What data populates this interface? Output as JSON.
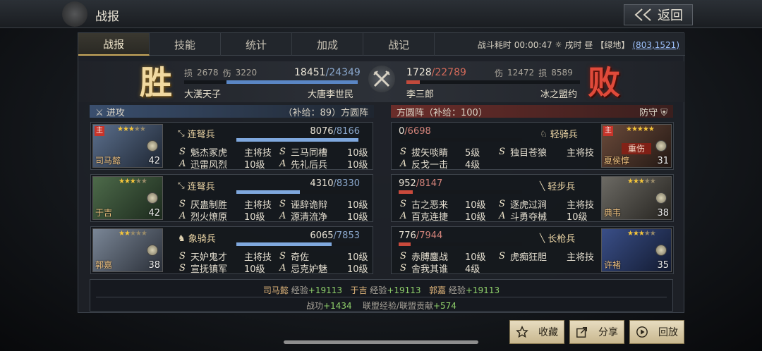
{
  "header": {
    "title": "战报",
    "back_label": "返回"
  },
  "tabs": [
    {
      "label": "战报"
    },
    {
      "label": "技能"
    },
    {
      "label": "统计"
    },
    {
      "label": "加成"
    },
    {
      "label": "战记"
    }
  ],
  "battle_info": {
    "duration_label": "战斗耗时",
    "duration": "00:00:47",
    "time_of_day": "戌时 昼",
    "terrain": "【绿地】",
    "coord": "(803,1521)"
  },
  "attacker": {
    "result": "胜",
    "loss_label": "损",
    "loss": "2678",
    "wound_label": "伤",
    "wound": "3220",
    "troops": "18451",
    "troops_max": "24349",
    "hp_fraction": 0.758,
    "alliance": "大漢天子",
    "player": "大唐李世民",
    "side_label": "进攻",
    "supply_text": "（补给：89）方圆阵"
  },
  "defender": {
    "result": "败",
    "loss_label": "损",
    "loss": "8589",
    "wound_label": "伤",
    "wound": "12472",
    "troops": "1728",
    "troops_max": "22789",
    "hp_fraction": 0.076,
    "alliance": "冰之盟约",
    "player": "李三郎",
    "side_label": "方圆阵（补给：100）",
    "stance": "防守"
  },
  "attack_cards": [
    {
      "name": "司马懿",
      "level": "42",
      "stars": 3,
      "main": "主",
      "troop": "连弩兵",
      "troop_icon": "crossbow-icon",
      "hp": "8076",
      "hp_max": "8166",
      "hp_fraction": 0.989,
      "skills": [
        {
          "type": "S",
          "name": "魁杰冢虎",
          "lv": "主将技"
        },
        {
          "type": "S",
          "name": "三马同槽",
          "lv": "10级"
        },
        {
          "type": "A",
          "name": "迅雷风烈",
          "lv": "10级"
        },
        {
          "type": "A",
          "name": "先礼后兵",
          "lv": "10级"
        }
      ]
    },
    {
      "name": "于吉",
      "level": "42",
      "stars": 3,
      "main": "",
      "troop": "连弩兵",
      "troop_icon": "crossbow-icon",
      "hp": "4310",
      "hp_max": "8330",
      "hp_fraction": 0.517,
      "skills": [
        {
          "type": "S",
          "name": "厌蛊制胜",
          "lv": "主将技"
        },
        {
          "type": "S",
          "name": "诬辞诡辩",
          "lv": "10级"
        },
        {
          "type": "A",
          "name": "烈火燎原",
          "lv": "10级"
        },
        {
          "type": "A",
          "name": "源清流净",
          "lv": "10级"
        }
      ]
    },
    {
      "name": "郭嘉",
      "level": "38",
      "stars": 2,
      "main": "",
      "troop": "象骑兵",
      "troop_icon": "elephant-icon",
      "hp": "6065",
      "hp_max": "7853",
      "hp_fraction": 0.772,
      "skills": [
        {
          "type": "S",
          "name": "天妒鬼才",
          "lv": "主将技"
        },
        {
          "type": "S",
          "name": "奇佐",
          "lv": "10级"
        },
        {
          "type": "S",
          "name": "宣抚镇军",
          "lv": "10级"
        },
        {
          "type": "A",
          "name": "忌克妒魅",
          "lv": "10级"
        }
      ]
    }
  ],
  "defense_cards": [
    {
      "name": "夏侯惇",
      "level": "31",
      "stars": 5,
      "main": "主",
      "status": "重伤",
      "troop": "轻骑兵",
      "troop_icon": "horse-icon",
      "hp": "0",
      "hp_max": "6698",
      "hp_fraction": 0,
      "skills": [
        {
          "type": "S",
          "name": "拔矢啖睛",
          "lv": "5级"
        },
        {
          "type": "S",
          "name": "独目苍狼",
          "lv": "主将技"
        },
        {
          "type": "A",
          "name": "反戈一击",
          "lv": "4级"
        }
      ]
    },
    {
      "name": "典韦",
      "level": "38",
      "stars": 3,
      "main": "",
      "troop": "轻步兵",
      "troop_icon": "sword-icon",
      "hp": "952",
      "hp_max": "8147",
      "hp_fraction": 0.117,
      "skills": [
        {
          "type": "S",
          "name": "古之恶来",
          "lv": "10级"
        },
        {
          "type": "S",
          "name": "逐虎过涧",
          "lv": "主将技"
        },
        {
          "type": "A",
          "name": "百克连捷",
          "lv": "10级"
        },
        {
          "type": "A",
          "name": "斗勇夺械",
          "lv": "10级"
        }
      ]
    },
    {
      "name": "许褚",
      "level": "35",
      "stars": 3,
      "main": "",
      "troop": "长枪兵",
      "troop_icon": "spear-icon",
      "hp": "776",
      "hp_max": "7944",
      "hp_fraction": 0.098,
      "skills": [
        {
          "type": "S",
          "name": "赤膊鏖战",
          "lv": "10级"
        },
        {
          "type": "S",
          "name": "虎痴狂胆",
          "lv": "主将技"
        },
        {
          "type": "S",
          "name": "舍我其谁",
          "lv": "4级"
        }
      ]
    }
  ],
  "rewards": {
    "exp_label": "经验",
    "exp": [
      {
        "name": "司马懿",
        "value": "+19113"
      },
      {
        "name": "于吉",
        "value": "+19113"
      },
      {
        "name": "郭嘉",
        "value": "+19113"
      }
    ],
    "merit_label": "战功",
    "merit": "+1434",
    "alliance_label": "联盟经验/联盟贡献",
    "alliance": "+574"
  },
  "buttons": {
    "collect": "收藏",
    "share": "分享",
    "replay": "回放"
  },
  "colors": {
    "attack": "#5a86c4",
    "defense": "#c24a3c",
    "gold": "#c9a85c"
  }
}
